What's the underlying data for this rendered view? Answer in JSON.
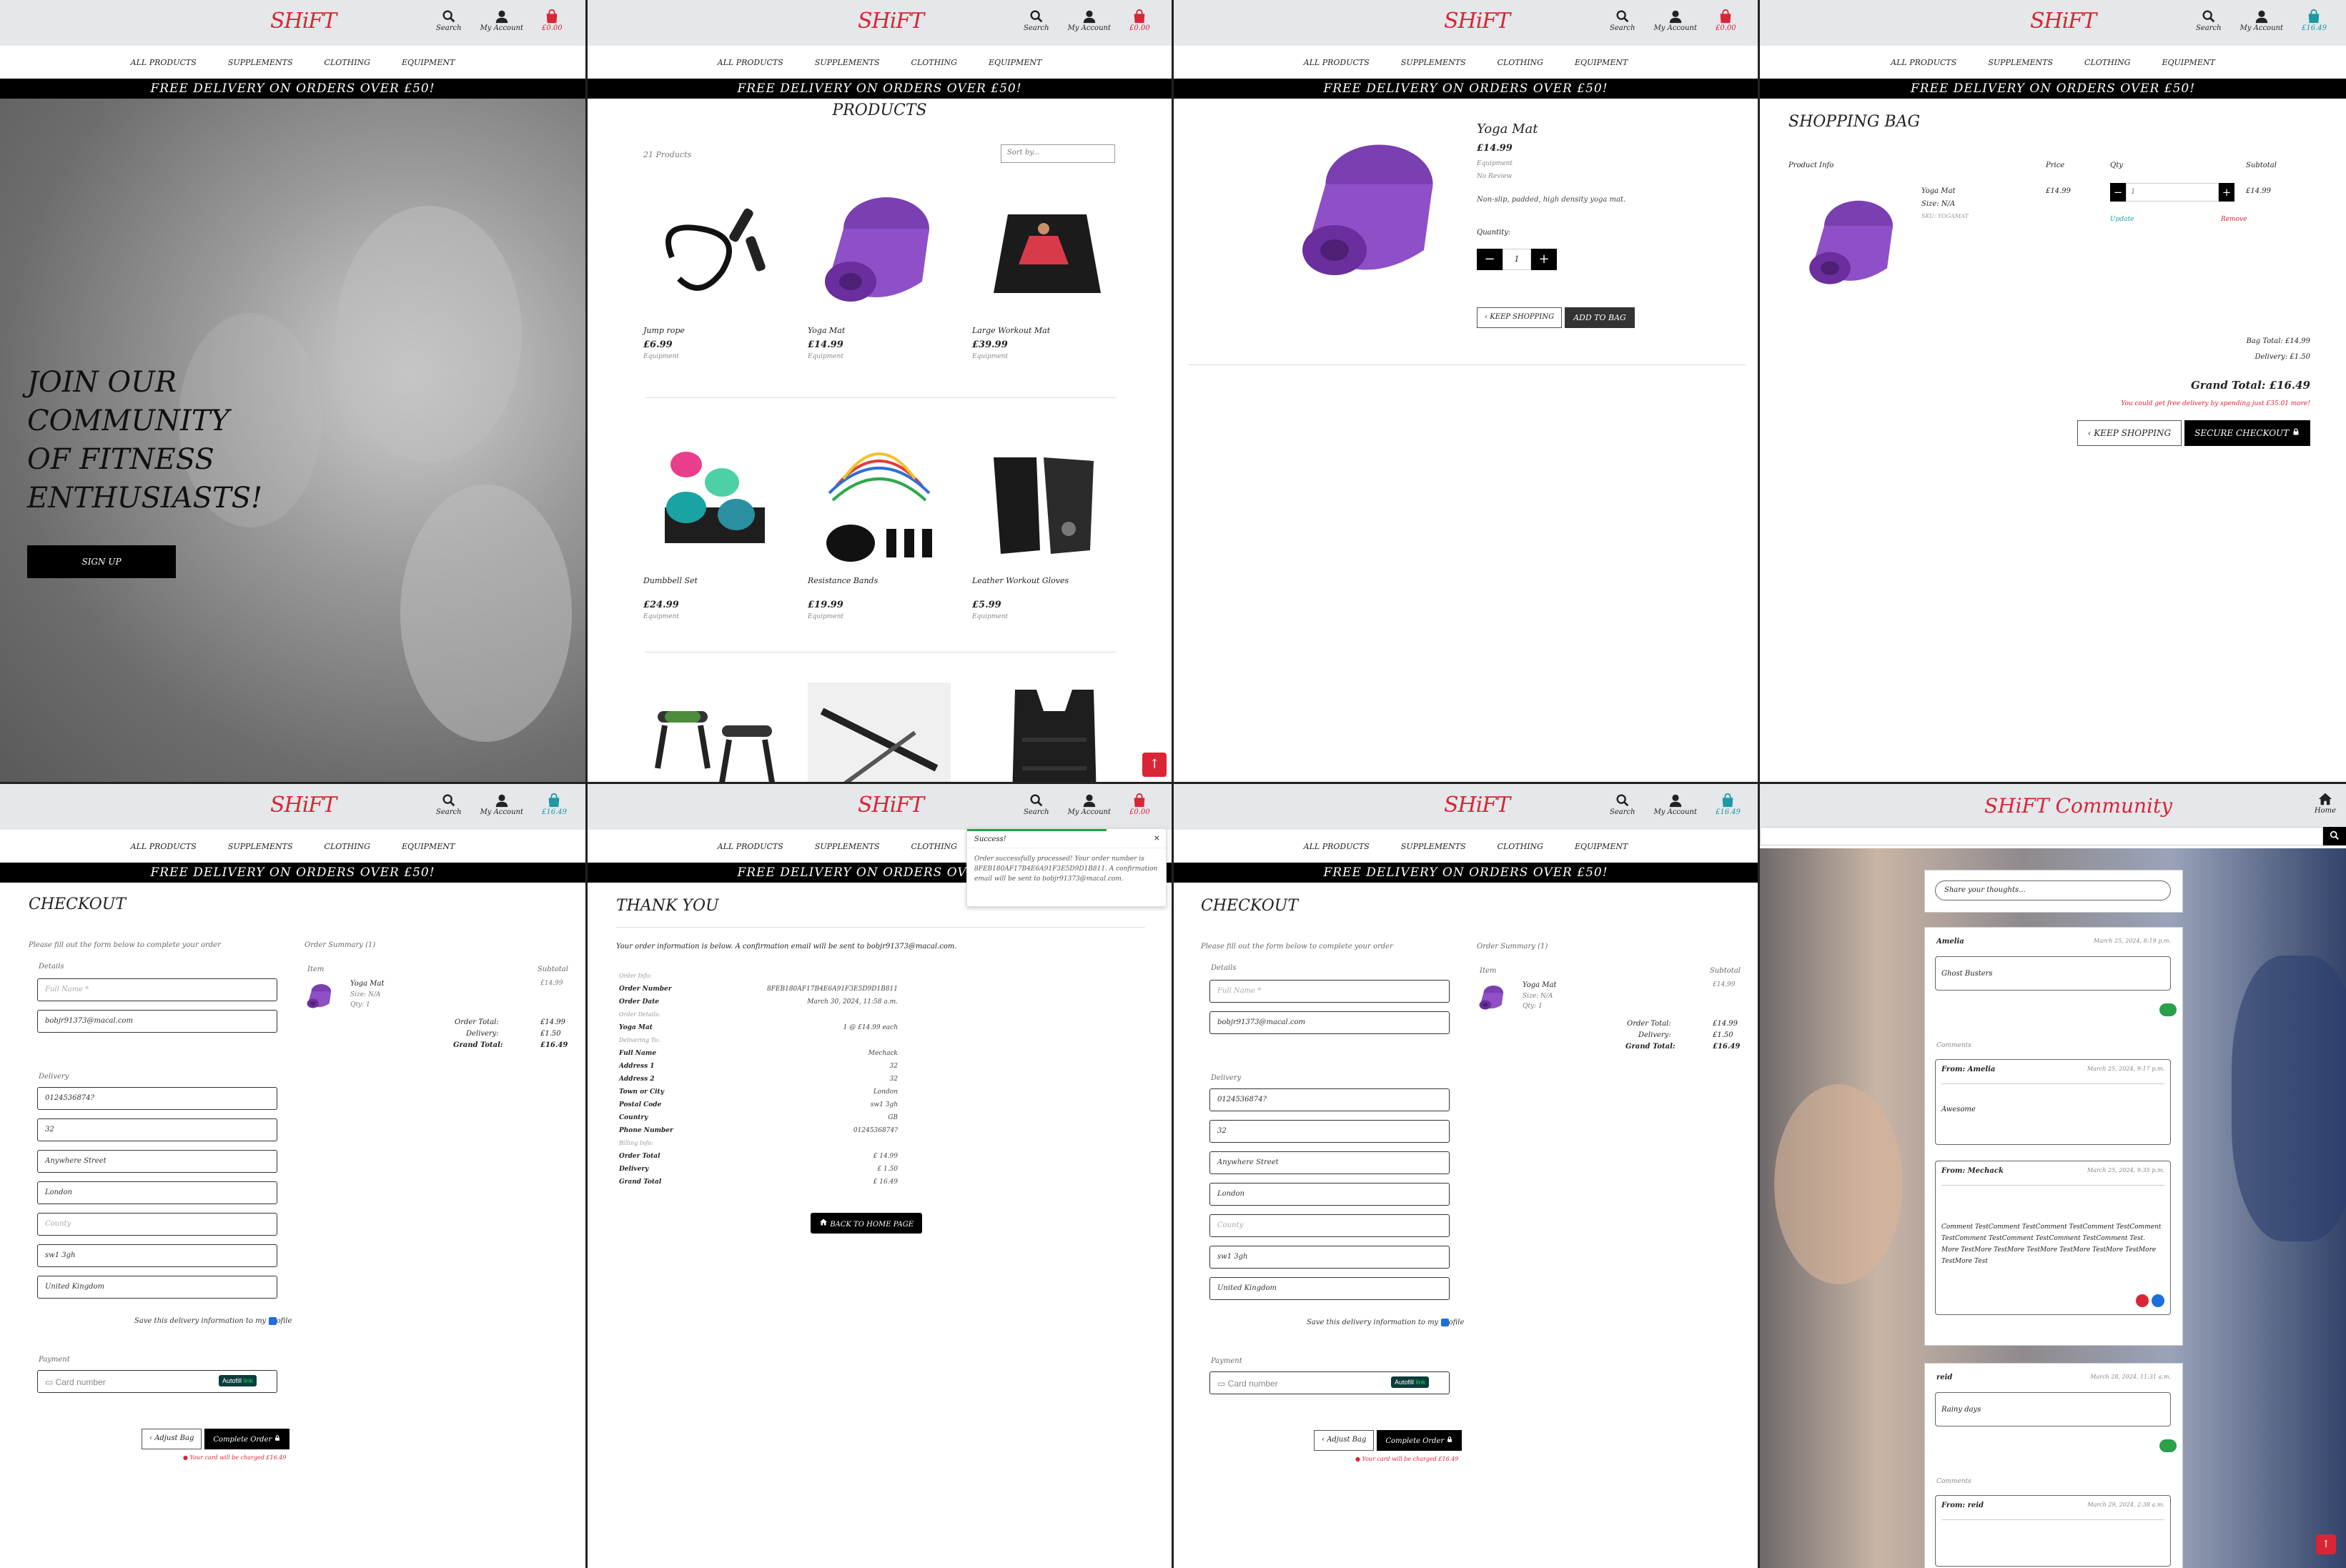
{
  "brand": {
    "logo": "SHiFT",
    "community_title": "SHiFT Community",
    "red": "#d92536",
    "teal": "#1a9aa6"
  },
  "header": {
    "search": "Search",
    "account": "My Account",
    "bag_empty": "£0.00",
    "bag_full": "£16.49"
  },
  "nav": {
    "all": "ALL PRODUCTS",
    "supplements": "SUPPLEMENTS",
    "clothing": "CLOTHING",
    "equipment": "EQUIPMENT"
  },
  "banner": "FREE DELIVERY ON ORDERS OVER £50!",
  "home": {
    "headline": "JOIN OUR COMMUNITY OF FITNESS ENTHUSIASTS!",
    "cta": "SIGN UP"
  },
  "products": {
    "title": "PRODUCTS",
    "count": "21 Products",
    "sort_placeholder": "Sort by...",
    "items": [
      {
        "name": "Jump rope",
        "price": "£6.99",
        "category": "Equipment"
      },
      {
        "name": "Yoga Mat",
        "price": "£14.99",
        "category": "Equipment"
      },
      {
        "name": "Large Workout Mat",
        "price": "£39.99",
        "category": "Equipment"
      },
      {
        "name": "Dumbbell Set",
        "price": "£24.99",
        "category": "Equipment"
      },
      {
        "name": "Resistance Bands",
        "price": "£19.99",
        "category": "Equipment"
      },
      {
        "name": "Leather Workout Gloves",
        "price": "£5.99",
        "category": "Equipment"
      }
    ]
  },
  "detail": {
    "name": "Yoga Mat",
    "price": "£14.99",
    "category": "Equipment",
    "rating": "No Review",
    "description": "Non-slip, padded, high density yoga mat.",
    "qty_label": "Quantity:",
    "qty": "1",
    "keep_shopping": "KEEP SHOPPING",
    "add_to_bag": "ADD TO BAG"
  },
  "bag": {
    "title": "SHOPPING BAG",
    "headers": {
      "info": "Product Info",
      "price": "Price",
      "qty": "Qty",
      "subtotal": "Subtotal"
    },
    "item": {
      "name": "Yoga Mat",
      "size": "Size: N/A",
      "sku": "SKU: YOGAMAT",
      "price": "£14.99",
      "qty": "1",
      "subtotal": "£14.99",
      "update": "Update",
      "remove": "Remove"
    },
    "bag_total": "Bag Total: £14.99",
    "delivery": "Delivery: £1.50",
    "grand_total": "Grand Total: £16.49",
    "free_note": "You could get free delivery by spending just £35.01 more!",
    "keep_shopping": "KEEP SHOPPING",
    "secure_checkout": "SECURE CHECKOUT"
  },
  "checkout": {
    "title": "CHECKOUT",
    "intro": "Please fill out the form below to complete your order",
    "summary_title": "Order Summary (1)",
    "details_label": "Details",
    "full_name_ph": "Full Name *",
    "email": "bobjr91373@macal.com",
    "delivery_label": "Delivery",
    "phone": "0124536874?",
    "addr1": "32",
    "addr2": "Anywhere Street",
    "city": "London",
    "county_ph": "County",
    "postcode": "sw1 3gh",
    "country": "United Kingdom",
    "save_info": "Save this delivery information to my profile",
    "payment_label": "Payment",
    "card_ph": "Card number",
    "autofill": "Autofill",
    "link": "link",
    "item_col": "Item",
    "subtotal_col": "Subtotal",
    "item_name": "Yoga Mat",
    "item_size": "Size: N/A",
    "item_qty": "Qty: 1",
    "item_price": "£14.99",
    "order_total_lbl": "Order Total:",
    "order_total": "£14.99",
    "delivery_lbl": "Delivery:",
    "delivery_val": "£1.50",
    "grand_lbl": "Grand Total:",
    "grand_val": "£16.49",
    "adjust_bag": "Adjust Bag",
    "complete": "Complete Order",
    "charge_note": "Your card will be charged £16.49"
  },
  "thanks": {
    "title": "THANK YOU",
    "intro": "Your order information is below. A confirmation email will be sent to bobjr91373@macal.com.",
    "toast_title": "Success!",
    "toast_body": "Order successfully processed! Your order number is 8FEB180AF17B4E6A91F3E5D9D1B811. A confirmation email will be sent to bobjr91373@macal.com.",
    "rows": [
      {
        "k": "Order Info:",
        "v": ""
      },
      {
        "k": "Order Number",
        "v": "8FEB180AF17B4E6A91F3E5D9D1B811"
      },
      {
        "k": "Order Date",
        "v": "March 30, 2024, 11:58 a.m."
      },
      {
        "k": "Order Details:",
        "v": ""
      },
      {
        "k": "Yoga Mat",
        "v": "1 @ £14.99 each"
      },
      {
        "k": "Delivering To:",
        "v": ""
      },
      {
        "k": "Full Name",
        "v": "Mechack"
      },
      {
        "k": "Address 1",
        "v": "32"
      },
      {
        "k": "Address 2",
        "v": "32"
      },
      {
        "k": "Town or City",
        "v": "London"
      },
      {
        "k": "Postal Code",
        "v": "sw1 3gh"
      },
      {
        "k": "Country",
        "v": "GB"
      },
      {
        "k": "Phone Number",
        "v": "0124536874?"
      },
      {
        "k": "Billing Info:",
        "v": ""
      },
      {
        "k": "Order Total",
        "v": "£ 14.99"
      },
      {
        "k": "Delivery",
        "v": "£ 1.50"
      },
      {
        "k": "Grand Total",
        "v": "£ 16.49"
      }
    ],
    "home_btn": "BACK TO HOME PAGE"
  },
  "community": {
    "home": "Home",
    "share_ph": "Share your thoughts...",
    "posts": [
      {
        "author": "Amelia",
        "date": "March 25, 2024, 8:19 p.m.",
        "body": "Ghost Busters"
      },
      {
        "author": "reid",
        "date": "March 28, 2024, 11:31 a.m.",
        "body": "Rainy days"
      }
    ],
    "comments_label": "Comments",
    "comments": [
      {
        "from": "From: Amelia",
        "date": "March 25, 2024, 9:17 p.m.",
        "body": "Awesome"
      },
      {
        "from": "From: Mechack",
        "date": "March 25, 2024, 9:35 p.m.",
        "body": "Comment TestComment TestComment TestComment TestComment TestComment TestComment TestComment TestComment Test. More TestMore TestMore TestMore TestMore TestMore TestMore TestMore Test"
      },
      {
        "from": "From: reid",
        "date": "March 29, 2024, 2:38 a.m.",
        "body": ""
      }
    ]
  }
}
